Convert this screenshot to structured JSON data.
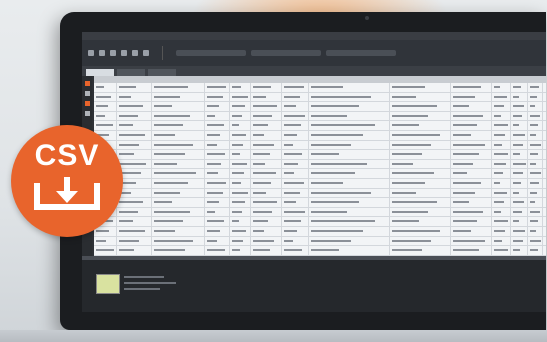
{
  "badge": {
    "label": "CSV",
    "icon": "download-icon",
    "color": "#e8642c"
  },
  "monitor": {
    "screen_bg": "#2e3136",
    "grid_bg": "#f2f4f6"
  }
}
